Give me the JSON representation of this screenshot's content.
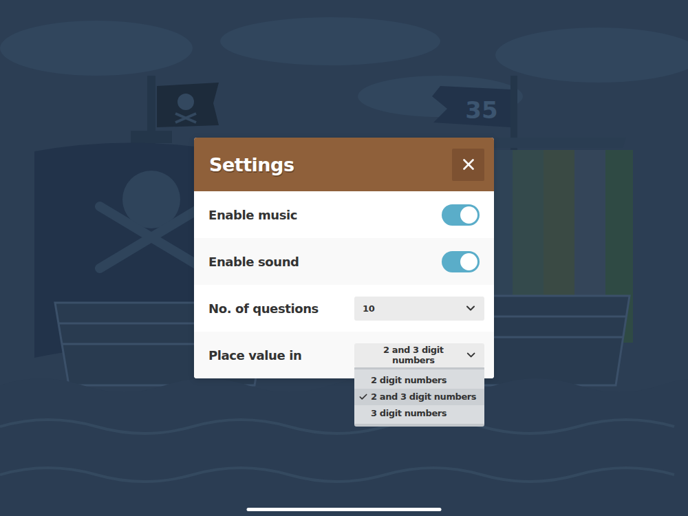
{
  "background": {
    "flag_number": "35"
  },
  "dialog": {
    "title": "Settings"
  },
  "settings": [
    {
      "kind": "toggle",
      "label": "Enable music",
      "on": true
    },
    {
      "kind": "toggle",
      "label": "Enable sound",
      "on": true
    },
    {
      "kind": "select",
      "label": "No. of questions",
      "value": "10",
      "expanded": false,
      "options": []
    },
    {
      "kind": "select",
      "label": "Place value in",
      "value": "2 and 3 digit numbers",
      "expanded": true,
      "options": [
        {
          "label": "2 digit numbers",
          "selected": false
        },
        {
          "label": "2 and 3 digit numbers",
          "selected": true
        },
        {
          "label": "3 digit numbers",
          "selected": false
        }
      ]
    }
  ]
}
